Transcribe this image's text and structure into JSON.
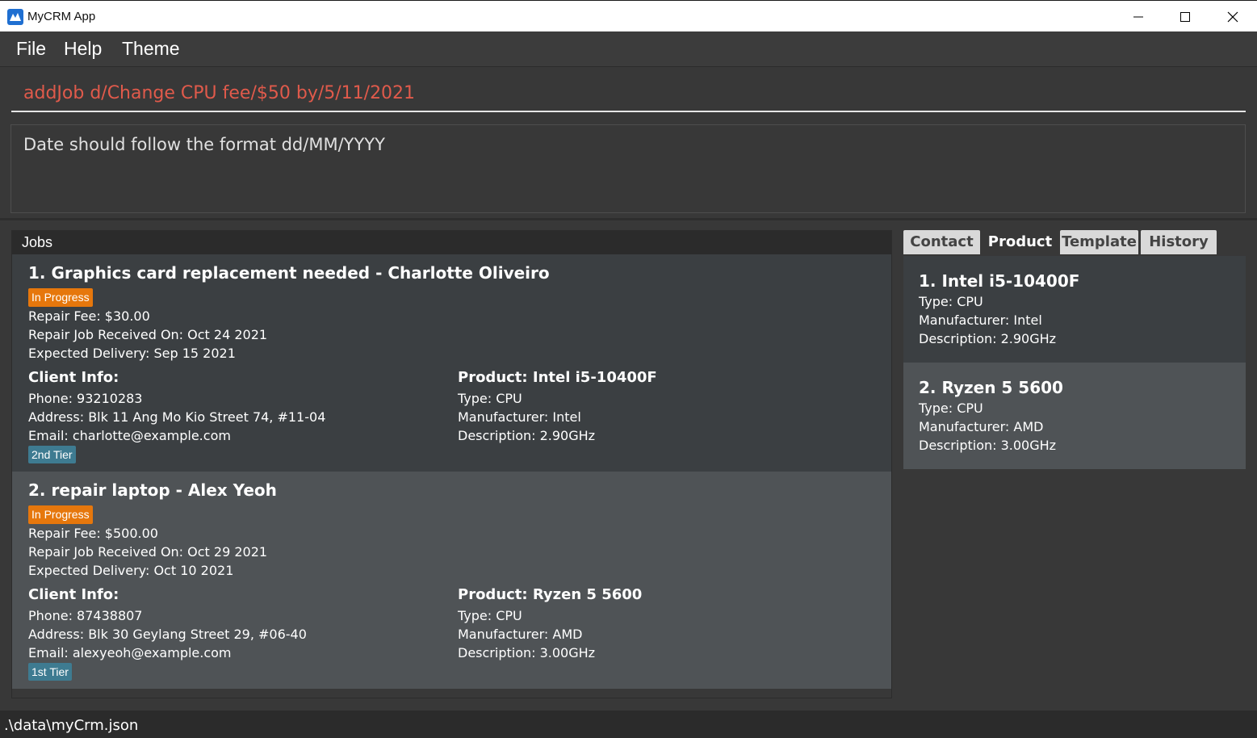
{
  "window": {
    "title": "MyCRM App"
  },
  "menu": {
    "file": "File",
    "help": "Help",
    "theme": "Theme"
  },
  "command": {
    "value": "addJob d/Change CPU fee/$50 by/5/11/2021"
  },
  "result": {
    "text": "Date should follow the format dd/MM/YYYY"
  },
  "jobs": {
    "header": "Jobs",
    "items": [
      {
        "title": "1. Graphics card replacement needed - Charlotte Oliveiro",
        "status": "In Progress",
        "fee": "Repair Fee: $30.00",
        "received": "Repair Job Received On: Oct 24 2021",
        "delivery": "Expected Delivery: Sep 15 2021",
        "client_head": "Client Info:",
        "phone": "Phone: 93210283",
        "address": "Address: Blk 11 Ang Mo Kio Street 74, #11-04",
        "email": "Email: charlotte@example.com",
        "tier": "2nd Tier",
        "product_head": "Product: Intel i5-10400F",
        "type": "Type: CPU",
        "manufacturer": "Manufacturer: Intel",
        "description": "Description: 2.90GHz"
      },
      {
        "title": "2. repair laptop - Alex Yeoh",
        "status": "In Progress",
        "fee": "Repair Fee: $500.00",
        "received": "Repair Job Received On: Oct 29 2021",
        "delivery": "Expected Delivery: Oct 10 2021",
        "client_head": "Client Info:",
        "phone": "Phone: 87438807",
        "address": "Address: Blk 30 Geylang Street 29, #06-40",
        "email": "Email: alexyeoh@example.com",
        "tier": "1st Tier",
        "product_head": "Product: Ryzen 5 5600",
        "type": "Type: CPU",
        "manufacturer": "Manufacturer: AMD",
        "description": "Description: 3.00GHz"
      }
    ]
  },
  "tabs": {
    "contact": "Contact",
    "product": "Product",
    "template": "Template",
    "history": "History",
    "active": "Product"
  },
  "products": [
    {
      "title": "1.  Intel i5-10400F",
      "type": "Type: CPU",
      "manufacturer": "Manufacturer: Intel",
      "description": "Description: 2.90GHz"
    },
    {
      "title": "2.  Ryzen 5 5600",
      "type": "Type: CPU",
      "manufacturer": "Manufacturer: AMD",
      "description": "Description: 3.00GHz"
    }
  ],
  "statusbar": {
    "path": ".\\data\\myCrm.json"
  },
  "colors": {
    "background": "#383838",
    "accent_status": "#e6770c",
    "tier_badge": "#3e7b91",
    "command_text": "#e05a4b"
  },
  "icons": {
    "app": "app-icon",
    "minimize": "minimize-icon",
    "maximize": "maximize-icon",
    "close": "close-icon"
  }
}
